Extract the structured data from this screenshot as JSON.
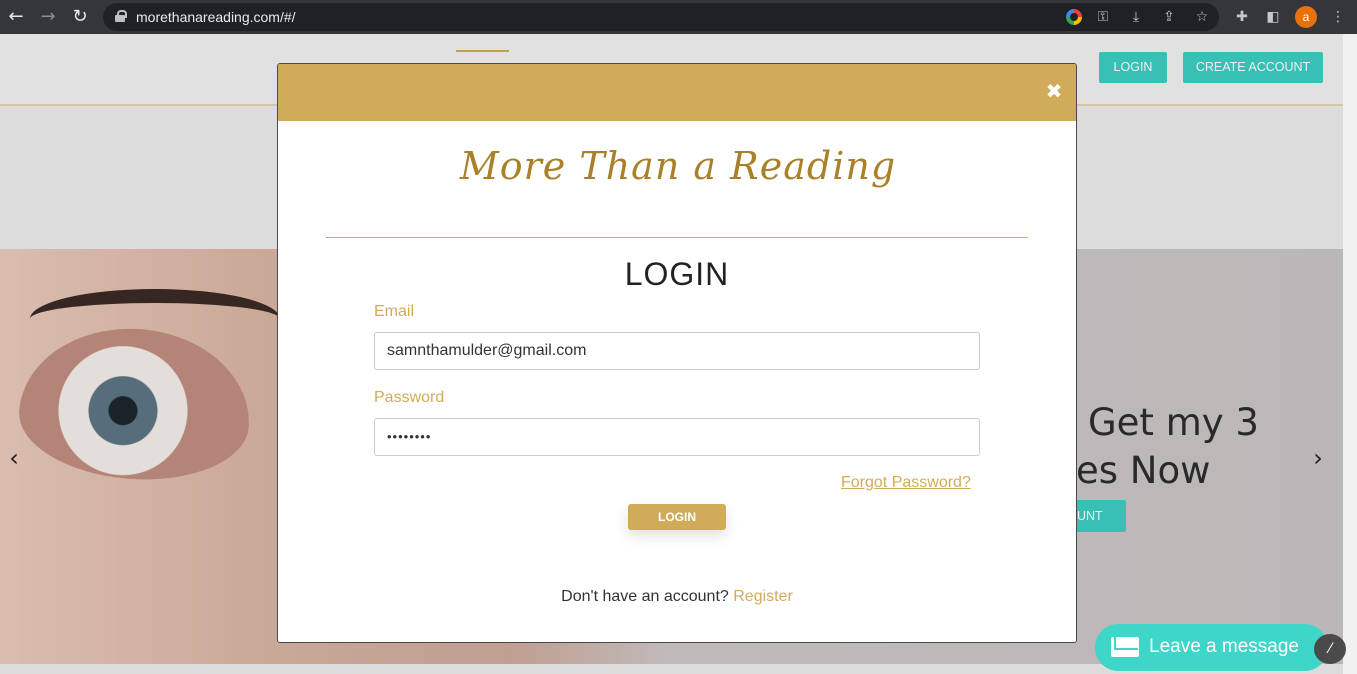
{
  "browser": {
    "url": "morethanareading.com/#/",
    "back_icon": "←",
    "forward_icon": "→",
    "reload_icon": "↻",
    "profile_initial": "a"
  },
  "site": {
    "header": {
      "login_label": "LOGIN",
      "create_account_label": "CREATE ACCOUNT"
    },
    "hero": {
      "line1": "Get my 3",
      "line2": "es Now",
      "button_label": "OUNT"
    }
  },
  "modal": {
    "logo_text": "More Than a Reading",
    "title": "LOGIN",
    "email_label": "Email",
    "email_value": "samnthamulder@gmail.com",
    "password_label": "Password",
    "password_value": "••••••••",
    "forgot_label": "Forgot Password?",
    "login_button_label": "LOGIN",
    "no_account_text": "Don't have an account?",
    "register_label": "Register"
  },
  "chat": {
    "label": "Leave a message"
  },
  "colors": {
    "gold": "#d0ac5a",
    "teal": "#3ccdc1",
    "chat_teal": "#3dd6c8"
  }
}
